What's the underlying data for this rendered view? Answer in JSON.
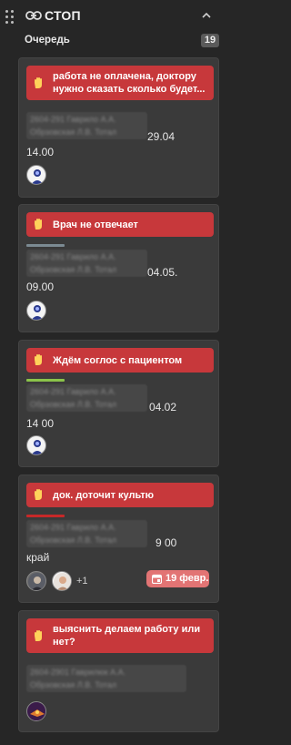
{
  "header": {
    "title": "СТОП",
    "queue_label": "Очередь",
    "queue_count": "19"
  },
  "colors": {
    "banner": "#c7383b",
    "card": "#3a3a3a",
    "bar_gray": "#7b8a92",
    "bar_green": "#8bc34a",
    "bar_red": "#c62828",
    "date_badge": "#e27474"
  },
  "cards": [
    {
      "banner": "работа не оплачена, доктору нужно сказать сколько будет...",
      "blurred_line1": "2604-291 Гаврило А.А.",
      "blurred_line2": "Обрзовская Л.В. Тотал",
      "suffix": "29.04",
      "line2": "14.00"
    },
    {
      "banner": "Врач не отвечает",
      "blurred_line1": "2604-291 Гаврило А.А.",
      "blurred_line2": "Обрзовская Л.В. Тотал",
      "suffix": "04.05.",
      "line2": "09.00"
    },
    {
      "banner": "Ждём соглос с пациентом",
      "blurred_line1": "2604-291 Гаврило А.А.",
      "blurred_line2": "Обрзовская Л.В. Тотал",
      "suffix": "04.02",
      "line2": "14 00"
    },
    {
      "banner": "док. доточит культю",
      "blurred_line1": "2604-291 Гаврило А.А.",
      "blurred_line2": "Обрзовская Л.В. Тотал",
      "suffix": "9 00",
      "line2": "край",
      "extra_assignees": "+1",
      "due_date": "19 февр."
    },
    {
      "banner": "выяснить делаем работу или нет?",
      "blurred_line1": "2604-2901 Гаврилюк А.А.",
      "blurred_line2": "Обрзовская Л.В. Тотал"
    }
  ]
}
